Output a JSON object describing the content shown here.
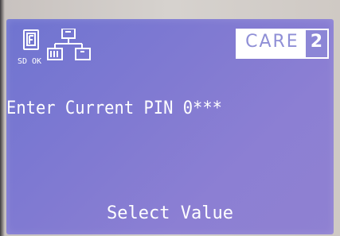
{
  "status_bar": {
    "icons": [
      "sd-card-icon",
      "network-tree-icon"
    ],
    "sd_label": "SD",
    "ok_label": "OK",
    "brand_label": "CARE",
    "brand_number": "2"
  },
  "main": {
    "prompt_text": "Enter Current PIN 0***"
  },
  "footer": {
    "softkey_label": "Select Value"
  },
  "colors": {
    "screen_background": "#7e79d2",
    "text": "#ffffff",
    "badge_text": "#8f8fd6",
    "badge_number_bg": "#8c86d6"
  }
}
